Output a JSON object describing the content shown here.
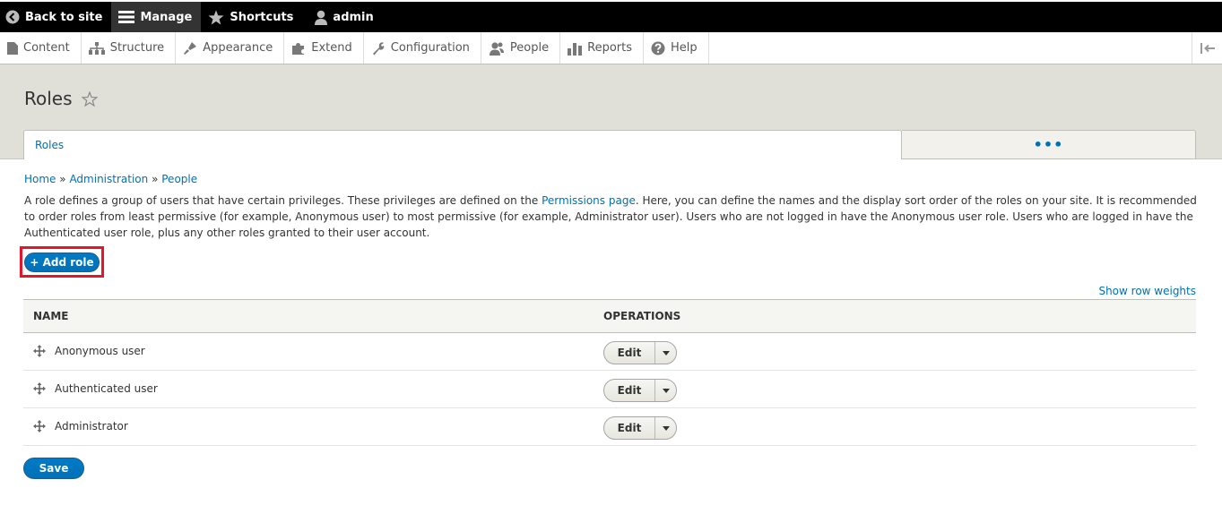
{
  "toolbar": {
    "back_label": "Back to site",
    "manage_label": "Manage",
    "shortcuts_label": "Shortcuts",
    "user_label": "admin"
  },
  "tray": {
    "items": [
      {
        "label": "Content",
        "icon": "file-icon"
      },
      {
        "label": "Structure",
        "icon": "sitemap-icon"
      },
      {
        "label": "Appearance",
        "icon": "brush-icon"
      },
      {
        "label": "Extend",
        "icon": "puzzle-icon"
      },
      {
        "label": "Configuration",
        "icon": "wrench-icon"
      },
      {
        "label": "People",
        "icon": "people-icon"
      },
      {
        "label": "Reports",
        "icon": "bar-chart-icon"
      },
      {
        "label": "Help",
        "icon": "question-icon"
      }
    ]
  },
  "page": {
    "title": "Roles",
    "tabs": {
      "primary": "Roles",
      "more": "•••"
    }
  },
  "breadcrumb": {
    "items": [
      "Home",
      "Administration",
      "People"
    ],
    "separator": "»"
  },
  "description": {
    "part1": "A role defines a group of users that have certain privileges. These privileges are defined on the ",
    "link": "Permissions page",
    "part2": ". Here, you can define the names and the display sort order of the roles on your site. It is recommended to order roles from least permissive (for example, Anonymous user) to most permissive (for example, Administrator user). Users who are not logged in have the Anonymous user role. Users who are logged in have the Authenticated user role, plus any other roles granted to their user account."
  },
  "actions": {
    "add_role": "+ Add role",
    "show_row_weights": "Show row weights",
    "save": "Save"
  },
  "table": {
    "headers": {
      "name": "NAME",
      "operations": "OPERATIONS"
    },
    "rows": [
      {
        "name": "Anonymous user",
        "op": "Edit"
      },
      {
        "name": "Authenticated user",
        "op": "Edit"
      },
      {
        "name": "Administrator",
        "op": "Edit"
      }
    ]
  },
  "colors": {
    "accent": "#0071b3",
    "highlight": "#e3162b",
    "toolbar_bg": "#000000",
    "header_bg": "#e0e0d8"
  }
}
